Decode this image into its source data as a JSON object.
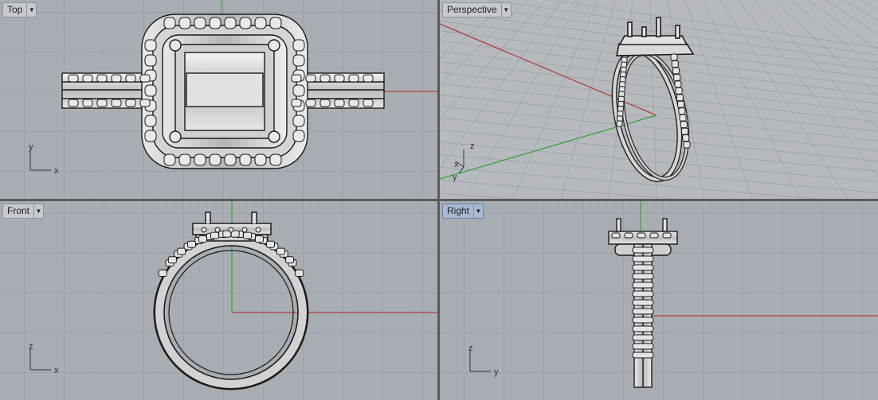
{
  "viewports": {
    "top": {
      "title": "Top",
      "axes": {
        "vertical": "y",
        "horizontal": "x"
      }
    },
    "perspective": {
      "title": "Perspective",
      "axes": {
        "up": "z",
        "a": "x",
        "b": "y"
      }
    },
    "front": {
      "title": "Front",
      "axes": {
        "vertical": "z",
        "horizontal": "x"
      }
    },
    "right": {
      "title": "Right",
      "axes": {
        "vertical": "z",
        "horizontal": "y"
      }
    }
  },
  "active_viewport": "Right",
  "icons": {
    "dropdown": "chevron-down-icon"
  },
  "colors": {
    "background": "#a9aeb4",
    "grid_minor": "#9ea3a9",
    "grid_major": "#8e949a",
    "x_axis": "#b04040",
    "y_axis": "#3aa03a",
    "tab_active": "#a9b9d3"
  }
}
